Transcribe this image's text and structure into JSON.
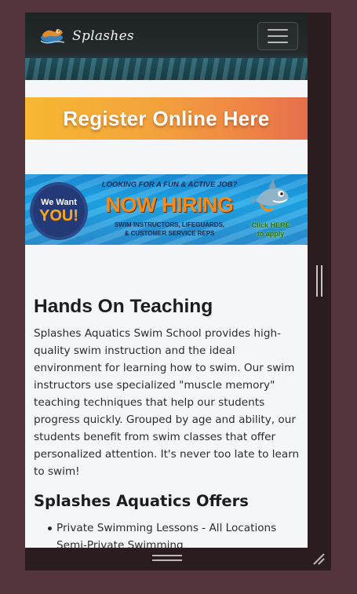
{
  "navbar": {
    "brand_name": "Splashes",
    "logo_icon": "swimmer-mascot-icon",
    "menu_icon": "hamburger-menu-icon"
  },
  "register_banner": {
    "text": "Register Online Here",
    "colors": {
      "from": "#f7b833",
      "to": "#e56f4c"
    }
  },
  "hiring_banner": {
    "badge_line1": "We Want",
    "badge_line2": "YOU!",
    "headline_small": "LOOKING FOR A FUN & ACTIVE JOB?",
    "headline_main": "NOW HIRING",
    "roles_line1": "SWIM INSTRUCTORS, LIFEGUARDS,",
    "roles_line2": "& CUSTOMER SERVICE REPS",
    "cta_line1": "Click HERE",
    "cta_line2": "to apply",
    "mascot_icon": "shark-mascot-icon"
  },
  "content": {
    "heading": "Hands On Teaching",
    "paragraph": "Splashes Aquatics Swim School provides high-quality swim instruction and the ideal environment for learning how to swim. Our swim instructors use specialized \"muscle memory\" teaching techniques that help our students progress quickly. Grouped by age and ability, our students benefit from swim classes that offer personalized attention. It's never too late to learn to swim!",
    "subheading": "Splashes Aquatics Offers",
    "offers": [
      "Private Swimming Lessons - All Locations",
      "Semi-Private Swimming"
    ]
  },
  "window_chrome": {
    "scroll_grip_icon": "scroll-grip-icon",
    "bottom_handle_icon": "drag-handle-icon",
    "resize_icon": "resize-corner-icon"
  }
}
